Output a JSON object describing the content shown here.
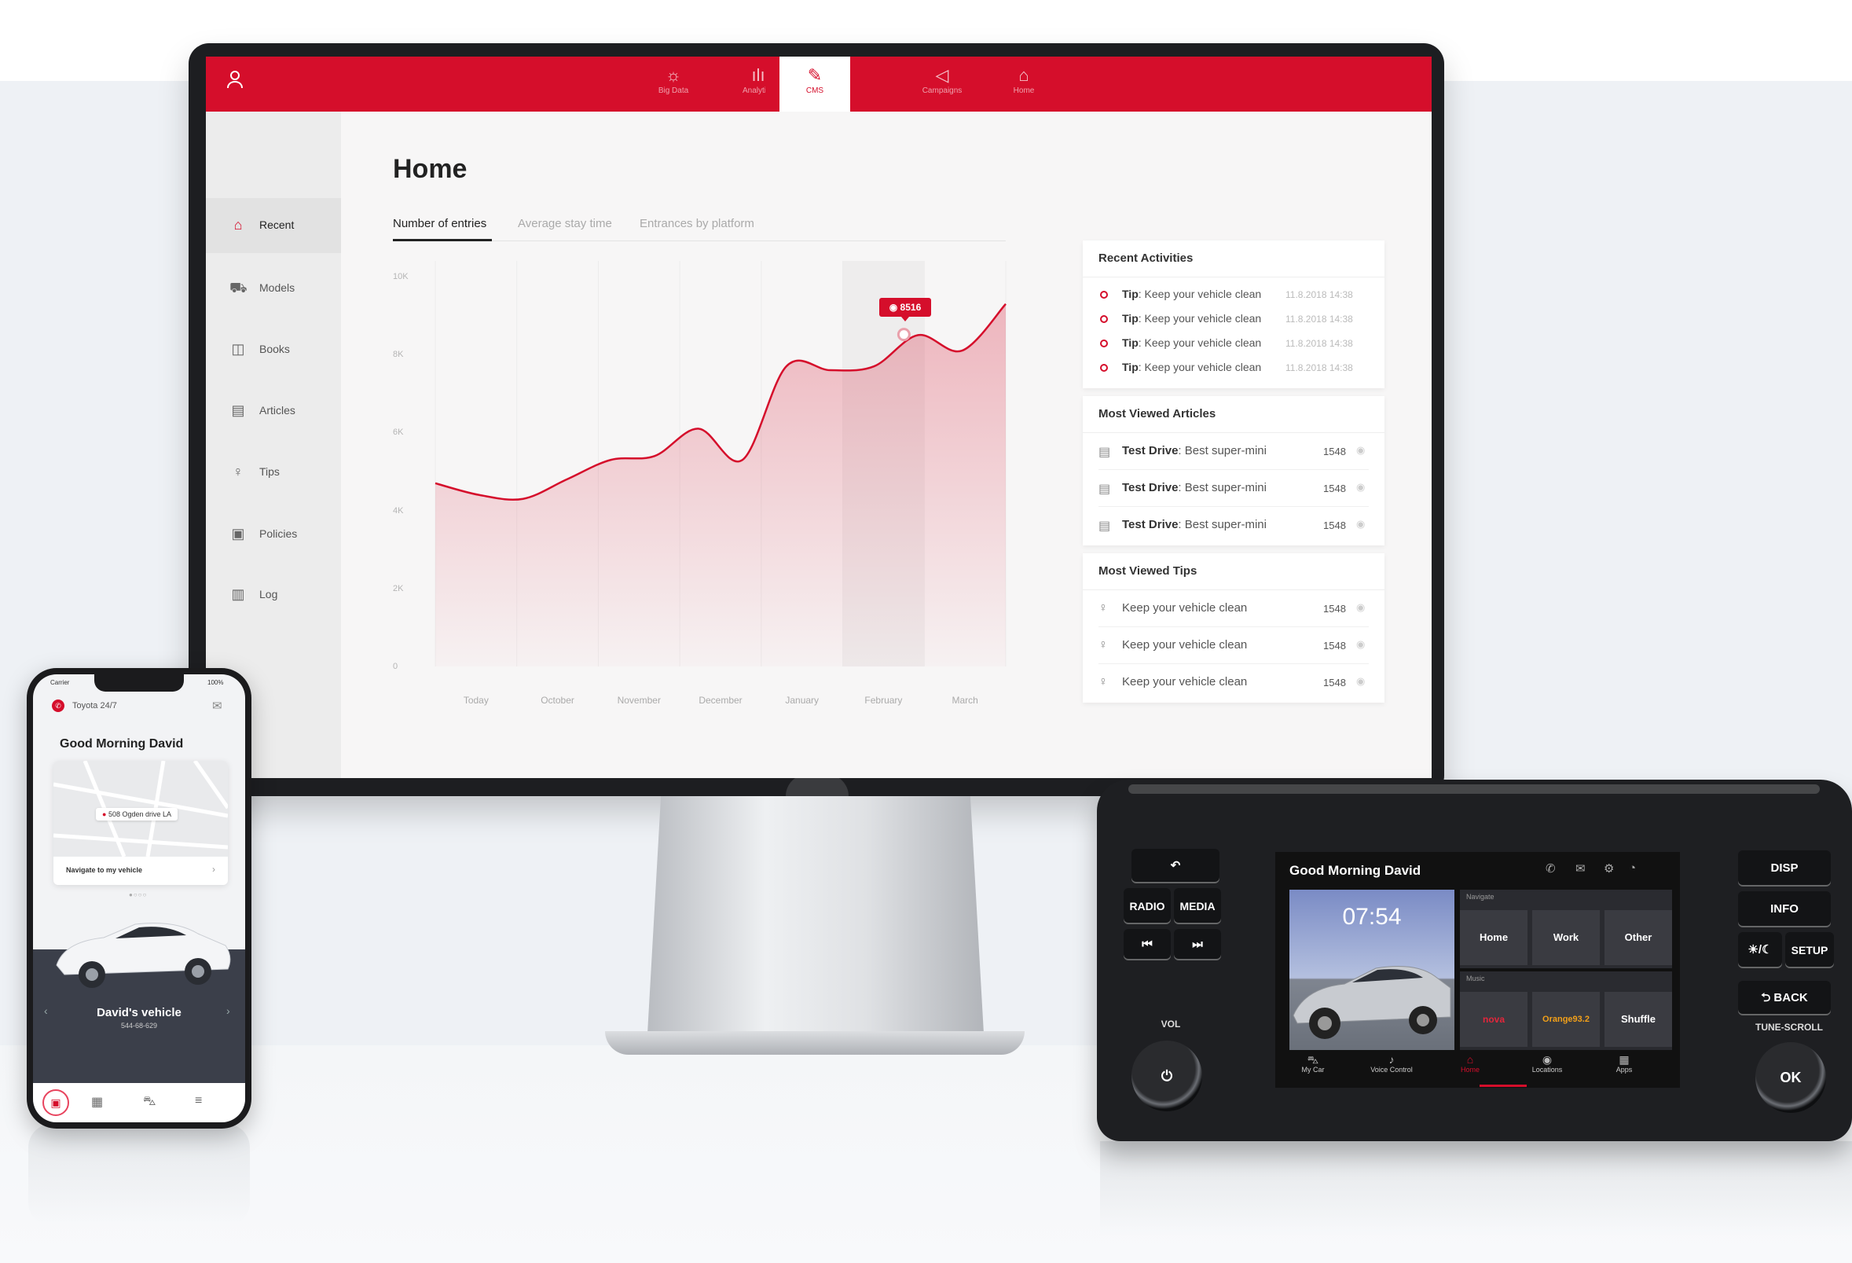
{
  "cms": {
    "nav": [
      {
        "label": "Big Data",
        "icon": "sun-icon"
      },
      {
        "label": "Analytics",
        "icon": "bar-chart-icon"
      },
      {
        "label": "CMS",
        "icon": "edit-icon"
      },
      {
        "label": "Campaigns",
        "icon": "megaphone-icon"
      },
      {
        "label": "Home",
        "icon": "home-icon"
      }
    ],
    "sidebar": [
      {
        "label": "Recent",
        "icon": "home-icon"
      },
      {
        "label": "Models",
        "icon": "car-icon"
      },
      {
        "label": "Books",
        "icon": "book-icon"
      },
      {
        "label": "Articles",
        "icon": "article-icon"
      },
      {
        "label": "Tips",
        "icon": "lightbulb-icon"
      },
      {
        "label": "Policies",
        "icon": "policy-icon"
      },
      {
        "label": "Log",
        "icon": "log-icon"
      }
    ],
    "page_title": "Home",
    "tabs": [
      "Number of entries",
      "Average stay time",
      "Entrances by platform"
    ],
    "tooltip": "8516",
    "recent_activities": {
      "title": "Recent Activities",
      "items": [
        {
          "prefix": "Tip",
          "text": ": Keep your vehicle clean",
          "date": "11.8.2018  14:38"
        },
        {
          "prefix": "Tip",
          "text": ": Keep your vehicle clean",
          "date": "11.8.2018  14:38"
        },
        {
          "prefix": "Tip",
          "text": ": Keep your vehicle clean",
          "date": "11.8.2018  14:38"
        },
        {
          "prefix": "Tip",
          "text": ": Keep your vehicle clean",
          "date": "11.8.2018  14:38"
        }
      ]
    },
    "most_viewed_articles": {
      "title": "Most Viewed Articles",
      "items": [
        {
          "prefix": "Test Drive",
          "text": ": Best super-mini",
          "count": "1548"
        },
        {
          "prefix": "Test Drive",
          "text": ": Best super-mini",
          "count": "1548"
        },
        {
          "prefix": "Test Drive",
          "text": ": Best super-mini",
          "count": "1548"
        }
      ]
    },
    "most_viewed_tips": {
      "title": "Most Viewed Tips",
      "items": [
        {
          "text": "Keep your vehicle clean",
          "count": "1548"
        },
        {
          "text": "Keep your vehicle clean",
          "count": "1548"
        },
        {
          "text": "Keep your vehicle clean",
          "count": "1548"
        }
      ]
    }
  },
  "chart_data": {
    "type": "area",
    "title": "",
    "xlabel": "",
    "ylabel": "",
    "categories": [
      "Today",
      "October",
      "November",
      "December",
      "January",
      "February",
      "March"
    ],
    "y_ticks": [
      "10K",
      "8K",
      "6K",
      "4K",
      "2K",
      "0"
    ],
    "ylim": [
      0,
      10000
    ],
    "x": [
      0,
      0.5,
      1,
      1.5,
      2,
      2.5,
      3,
      3.5,
      4,
      4.5,
      5,
      5.5,
      6,
      6.5
    ],
    "y": [
      4700,
      4400,
      4300,
      4800,
      5300,
      5400,
      6100,
      5300,
      7700,
      7600,
      7700,
      8500,
      8100,
      9300
    ],
    "highlight": {
      "category": "February",
      "value": 8516
    },
    "grid": "vertical",
    "color": "#d50e2b"
  },
  "phone": {
    "carrier": "Carrier",
    "battery": "100%",
    "brand": "Toyota 24/7",
    "greeting": "Good Morning David",
    "address": "508 Ogden drive LA",
    "navigate": "Navigate to my vehicle",
    "vehicle_name": "David's vehicle",
    "vehicle_plate": "544-68-629"
  },
  "car": {
    "greeting": "Good Morning David",
    "time": "07:54",
    "navigate_label": "Navigate",
    "nav_buttons": [
      "Home",
      "Work",
      "Other"
    ],
    "music_label": "Music",
    "music_buttons": [
      "nova",
      "Orange93.2",
      "Shuffle"
    ],
    "bottom_tabs": [
      "My Car",
      "Voice Control",
      "Home",
      "Locations",
      "Apps"
    ],
    "hw_left": [
      "RADIO",
      "MEDIA",
      "VOL"
    ],
    "hw_right": [
      "DISP",
      "INFO",
      "SETUP",
      "BACK",
      "TUNE-SCROLL",
      "OK"
    ],
    "accent": "#d50e2b"
  }
}
